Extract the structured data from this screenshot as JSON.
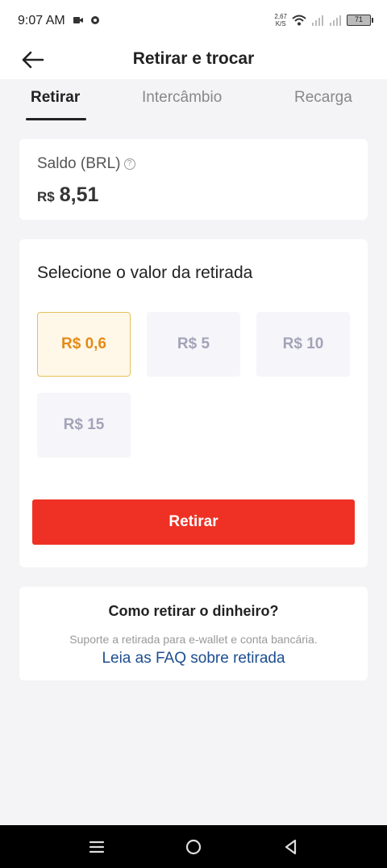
{
  "status_bar": {
    "time": "9:07 AM",
    "net_speed_value": "2,67",
    "net_speed_unit": "K/S",
    "battery": "71"
  },
  "header": {
    "title": "Retirar e trocar",
    "back_icon": "arrow-left-icon"
  },
  "tabs": [
    {
      "label": "Retirar",
      "active": true
    },
    {
      "label": "Intercâmbio",
      "active": false
    },
    {
      "label": "Recarga",
      "active": false
    }
  ],
  "balance": {
    "label": "Saldo (BRL)",
    "currency": "R$",
    "amount": "8,51"
  },
  "withdraw": {
    "title": "Selecione o valor da retirada",
    "options": [
      {
        "label": "R$ 0,6",
        "selected": true
      },
      {
        "label": "R$ 5",
        "selected": false
      },
      {
        "label": "R$ 10",
        "selected": false
      },
      {
        "label": "R$ 15",
        "selected": false
      }
    ],
    "button_label": "Retirar"
  },
  "info": {
    "title": "Como retirar o dinheiro?",
    "description": "Suporte a retirada para e-wallet e conta bancária.",
    "faq_link": "Leia as FAQ sobre retirada"
  },
  "colors": {
    "accent": "#ee3124",
    "selected_text": "#e58a17",
    "selected_border": "#e7c05a",
    "link": "#1d4e8f"
  }
}
